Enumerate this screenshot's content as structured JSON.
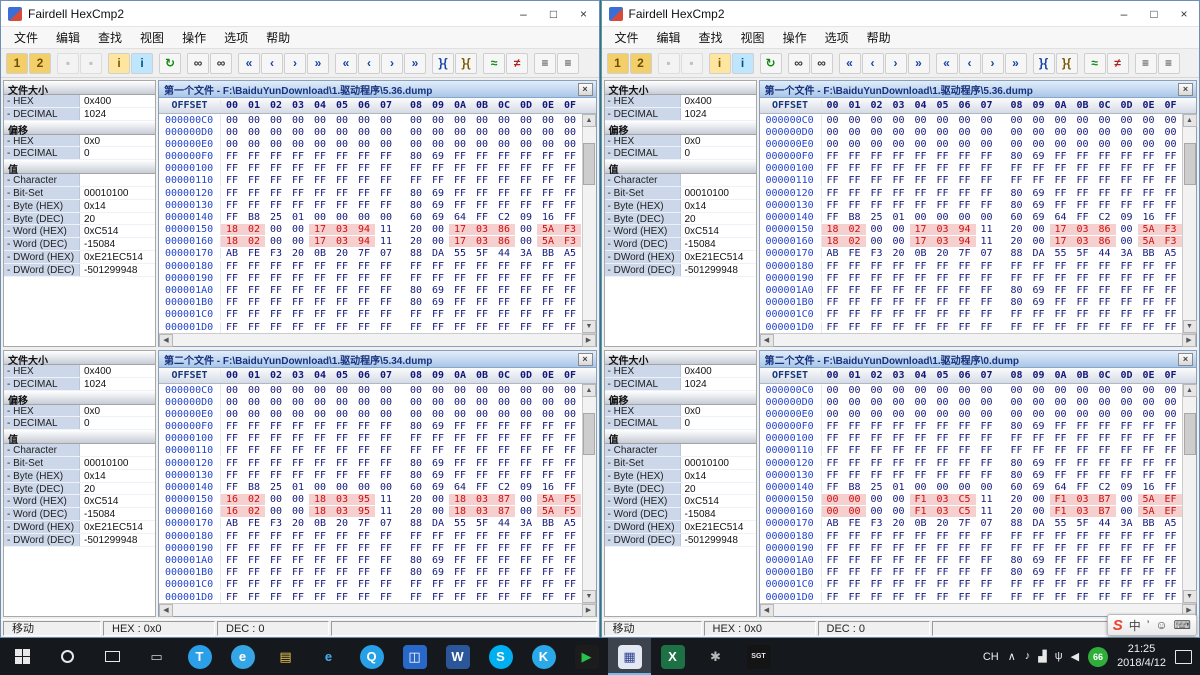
{
  "chrome": {
    "minimize_glyph": "–",
    "maximize_glyph": "□",
    "close_glyph": "×",
    "panel_close_glyph": "×",
    "scroll_up_glyph": "▲",
    "scroll_down_glyph": "▼",
    "scroll_left_glyph": "◀",
    "scroll_right_glyph": "▶"
  },
  "shared": {
    "menu": [
      "文件",
      "编辑",
      "查找",
      "视图",
      "操作",
      "选项",
      "帮助"
    ],
    "toolbar": [
      {
        "name": "open-file1-button",
        "glyph": "1",
        "color": "#6b4e00",
        "bg": "#f3cf6a"
      },
      {
        "name": "open-file2-button",
        "glyph": "2",
        "color": "#6b4e00",
        "bg": "#f3cf6a"
      },
      {
        "name": "save-file1-button",
        "glyph": "▪",
        "color": "#9a9a9a",
        "disabled": true,
        "sep": true
      },
      {
        "name": "save-file2-button",
        "glyph": "▪",
        "color": "#9a9a9a",
        "disabled": true
      },
      {
        "name": "file1-info-button",
        "glyph": "i",
        "color": "#7a5a00",
        "bg": "#ffe6a0",
        "sep": true
      },
      {
        "name": "file2-info-button",
        "glyph": "i",
        "color": "#00557a",
        "bg": "#bfe6ff"
      },
      {
        "name": "recompare-button",
        "glyph": "↻",
        "color": "#0d8a0d",
        "sep": true
      },
      {
        "name": "find-button",
        "glyph": "∞",
        "color": "#333333",
        "sep": true
      },
      {
        "name": "find-next-button",
        "glyph": "∞",
        "color": "#333333"
      },
      {
        "name": "first-diff-button",
        "glyph": "«",
        "color": "#1545a8",
        "sep": true
      },
      {
        "name": "prev-diff-button",
        "glyph": "‹",
        "color": "#1545a8"
      },
      {
        "name": "next-diff-button",
        "glyph": "›",
        "color": "#1545a8"
      },
      {
        "name": "last-diff-button",
        "glyph": "»",
        "color": "#1545a8"
      },
      {
        "name": "first-byte-diff-button",
        "glyph": "«",
        "color": "#1545a8",
        "sep": true
      },
      {
        "name": "prev-byte-diff-button",
        "glyph": "‹",
        "color": "#1545a8"
      },
      {
        "name": "next-byte-diff-button",
        "glyph": "›",
        "color": "#1545a8"
      },
      {
        "name": "last-byte-diff-button",
        "glyph": "»",
        "color": "#1545a8"
      },
      {
        "name": "goto-offset-button",
        "glyph": "}{",
        "color": "#1545a8",
        "sep": true
      },
      {
        "name": "sync-views-button",
        "glyph": "}{",
        "color": "#7a5a00"
      },
      {
        "name": "compare-equal-button",
        "glyph": "≈",
        "color": "#0d8a0d",
        "sep": true
      },
      {
        "name": "compare-diff-button",
        "glyph": "≠",
        "color": "#b02020"
      },
      {
        "name": "diff-list-button",
        "glyph": "≡",
        "color": "#333333",
        "sep": true
      },
      {
        "name": "diff-list2-button",
        "glyph": "≡",
        "color": "#333333"
      }
    ],
    "sidebar": {
      "groups": [
        {
          "title": "文件大小",
          "rows": [
            [
              "- HEX",
              "0x400"
            ],
            [
              "- DECIMAL",
              "1024"
            ]
          ]
        },
        {
          "title": "偏移",
          "rows": [
            [
              "- HEX",
              "0x0"
            ],
            [
              "- DECIMAL",
              "0"
            ]
          ]
        },
        {
          "title": "值",
          "rows": [
            [
              "- Character",
              ""
            ],
            [
              "- Bit-Set",
              "00010100"
            ],
            [
              "- Byte (HEX)",
              "0x14"
            ],
            [
              "- Byte (DEC)",
              "20"
            ],
            [
              "- Word (HEX)",
              "0xC514"
            ],
            [
              "- Word (DEC)",
              "-15084"
            ],
            [
              "- DWord (HEX)",
              "0xE21EC514"
            ],
            [
              "- DWord (DEC)",
              "-501299948"
            ]
          ]
        }
      ]
    },
    "hex": {
      "offset_label": "OFFSET",
      "cols": [
        "00",
        "01",
        "02",
        "03",
        "04",
        "05",
        "06",
        "07",
        "08",
        "09",
        "0A",
        "0B",
        "0C",
        "0D",
        "0E",
        "0F"
      ],
      "patterns": {
        "zeros": "00 00 00 00 00 00 00 00 00 00 00 00 00 00 00 00",
        "ffs": "FF FF FF FF FF FF FF FF FF FF FF FF FF FF FF FF",
        "ff8069": "FF FF FF FF FF FF FF FF 80 69 FF FF FF FF FF FF",
        "mix140": "FF B8 25 01 00 00 00 00 60 69 64 FF C2 09 16 FF",
        "mix170": "AB FE F3 20 0B 20 7F 07 88 DA 55 5F 44 3A BB A5",
        "diff536": "18 02 00 00 17 03 94 11 20 00 17 03 86 00 5A F3",
        "diff534": "16 02 00 00 18 03 95 11 20 00 18 03 87 00 5A F5",
        "diff0": "00 00 00 00 F1 03 C5 11 20 00 F1 03 B7 00 5A EF"
      },
      "diff_cols": [
        0,
        1,
        4,
        5,
        6,
        10,
        11,
        12,
        14,
        15
      ],
      "row_layout": [
        {
          "offset": "000000C0",
          "pattern": "zeros"
        },
        {
          "offset": "000000D0",
          "pattern": "zeros"
        },
        {
          "offset": "000000E0",
          "pattern": "zeros"
        },
        {
          "offset": "000000F0",
          "pattern": "ff8069"
        },
        {
          "offset": "00000100",
          "pattern": "ffs"
        },
        {
          "offset": "00000110",
          "pattern": "ffs"
        },
        {
          "offset": "00000120",
          "pattern": "ff8069"
        },
        {
          "offset": "00000130",
          "pattern": "ff8069"
        },
        {
          "offset": "00000140",
          "pattern": "mix140"
        },
        {
          "offset": "00000150",
          "pattern": "DIFF"
        },
        {
          "offset": "00000160",
          "pattern": "DIFF"
        },
        {
          "offset": "00000170",
          "pattern": "mix170"
        },
        {
          "offset": "00000180",
          "pattern": "ffs"
        },
        {
          "offset": "00000190",
          "pattern": "ffs"
        },
        {
          "offset": "000001A0",
          "pattern": "ff8069"
        },
        {
          "offset": "000001B0",
          "pattern": "ff8069"
        },
        {
          "offset": "000001C0",
          "pattern": "ffs"
        },
        {
          "offset": "000001D0",
          "pattern": "ffs"
        }
      ]
    },
    "status": {
      "mode": "移动",
      "hex": "HEX : 0x0",
      "dec": "DEC : 0"
    }
  },
  "windows": [
    {
      "title": "Fairdell HexCmp2",
      "panels": [
        {
          "title": "第一个文件 - F:\\BaiduYunDownload\\1.驱动程序\\5.36.dump",
          "diff_pattern": "diff536"
        },
        {
          "title": "第二个文件 - F:\\BaiduYunDownload\\1.驱动程序\\5.34.dump",
          "diff_pattern": "diff534"
        }
      ]
    },
    {
      "title": "Fairdell HexCmp2",
      "panels": [
        {
          "title": "第一个文件 - F:\\BaiduYunDownload\\1.驱动程序\\5.36.dump",
          "diff_pattern": "diff536"
        },
        {
          "title": "第二个文件 - F:\\BaiduYunDownload\\1.驱动程序\\0.dump",
          "diff_pattern": "diff0"
        }
      ]
    }
  ],
  "taskbar": {
    "apps": [
      {
        "name": "taskbar-app-device",
        "glyph": "▭",
        "fg": "#c9d4dc",
        "shape": "plain"
      },
      {
        "name": "taskbar-app-tim",
        "glyph": "T",
        "bg": "#2ba0e8",
        "shape": "circle"
      },
      {
        "name": "taskbar-app-browser",
        "glyph": "e",
        "bg": "#35a5e5",
        "shape": "circle"
      },
      {
        "name": "taskbar-app-explorer",
        "glyph": "▤",
        "fg": "#f2c94c",
        "shape": "plain"
      },
      {
        "name": "taskbar-app-ie",
        "glyph": "e",
        "fg": "#45b0f0",
        "shape": "plain"
      },
      {
        "name": "taskbar-app-qq",
        "glyph": "Q",
        "bg": "#28a0e8",
        "shape": "circle"
      },
      {
        "name": "taskbar-app-app1",
        "glyph": "◫",
        "bg": "#2868c8",
        "shape": "square"
      },
      {
        "name": "taskbar-app-word",
        "glyph": "W",
        "bg": "#2b579a",
        "shape": "square"
      },
      {
        "name": "taskbar-app-skype",
        "glyph": "S",
        "bg": "#00aff0",
        "shape": "circle"
      },
      {
        "name": "taskbar-app-kugou",
        "glyph": "K",
        "bg": "#2ba8e8",
        "shape": "circle"
      },
      {
        "name": "taskbar-app-player",
        "glyph": "▶",
        "bg": "#1c1c1c",
        "fg": "#27c24c",
        "shape": "square"
      },
      {
        "name": "taskbar-app-hexcmp",
        "glyph": "▦",
        "bg": "#e4e8f2",
        "fg": "#2a3f8f",
        "shape": "square",
        "active": true
      },
      {
        "name": "taskbar-app-excel",
        "glyph": "X",
        "bg": "#1e7145",
        "shape": "square"
      },
      {
        "name": "taskbar-app-tools",
        "glyph": "✱",
        "fg": "#b8b8b8",
        "shape": "plain"
      },
      {
        "name": "taskbar-app-sgt",
        "glyph": "SGT",
        "bg": "#141414",
        "fg": "#e8e8e8",
        "shape": "square",
        "small": true
      }
    ],
    "tray": {
      "language": "CH",
      "up_arrow": "∧",
      "icons": [
        {
          "name": "sound-icon",
          "glyph": "♪"
        },
        {
          "name": "network-icon",
          "glyph": "▟"
        },
        {
          "name": "usb-icon",
          "glyph": "ψ"
        },
        {
          "name": "volume-icon",
          "glyph": "◀"
        }
      ],
      "battery": "66",
      "time": "21:25",
      "date": "2018/4/12"
    }
  },
  "sogou_bar": {
    "items": [
      {
        "name": "sogou-logo",
        "glyph": "S",
        "logo": true
      },
      {
        "name": "input-mode-chinese",
        "glyph": "中"
      },
      {
        "name": "punctuation-mode-icon",
        "glyph": "’"
      },
      {
        "name": "emoji-icon",
        "glyph": "☺"
      },
      {
        "name": "keyboard-icon",
        "glyph": "⌨"
      }
    ]
  }
}
